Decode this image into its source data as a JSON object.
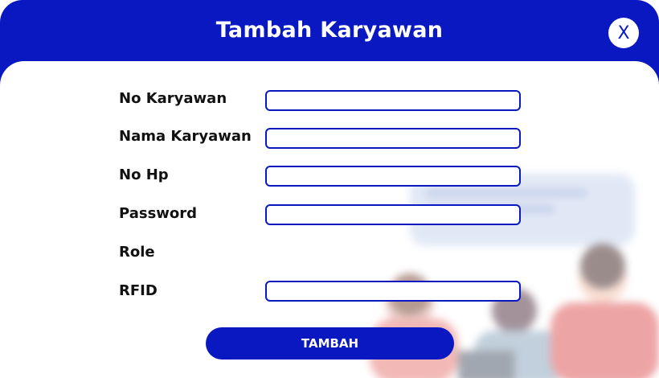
{
  "dialog": {
    "title": "Tambah Karyawan",
    "close_label": "X"
  },
  "form": {
    "fields": [
      {
        "label": "No Karyawan",
        "value": "",
        "placeholder": ""
      },
      {
        "label": "Nama Karyawan",
        "value": "",
        "placeholder": ""
      },
      {
        "label": "No Hp",
        "value": "",
        "placeholder": ""
      },
      {
        "label": "Password",
        "value": "",
        "placeholder": ""
      },
      {
        "label": "Role"
      },
      {
        "label": "RFID",
        "value": "",
        "placeholder": ""
      }
    ],
    "submit_label": "TAMBAH"
  },
  "colors": {
    "primary": "#0a18c2",
    "background": "#ffffff",
    "text": "#111111"
  }
}
